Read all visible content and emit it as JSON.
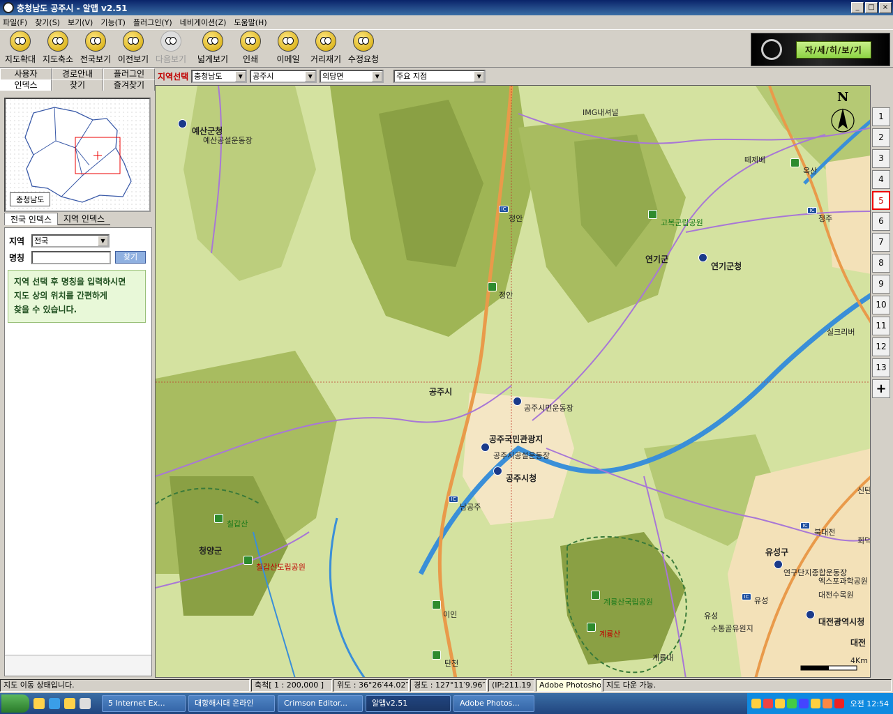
{
  "window": {
    "title": "충청남도 공주시 - 알맵 v2.51"
  },
  "menu": [
    "파일(F)",
    "찾기(S)",
    "보기(V)",
    "기능(T)",
    "플러그인(Y)",
    "네비게이션(Z)",
    "도움말(H)"
  ],
  "toolbar": {
    "items": [
      {
        "label": "지도확대",
        "icon": "zoom-in-icon",
        "enabled": true
      },
      {
        "label": "지도축소",
        "icon": "zoom-out-icon",
        "enabled": true
      },
      {
        "label": "전국보기",
        "icon": "country-view-icon",
        "enabled": true
      },
      {
        "label": "이전보기",
        "icon": "previous-view-icon",
        "enabled": true
      },
      {
        "label": "다음보기",
        "icon": "next-view-icon",
        "enabled": false
      },
      {
        "label": "넓게보기",
        "icon": "wide-view-icon",
        "enabled": true
      },
      {
        "label": "인쇄",
        "icon": "print-icon",
        "enabled": true
      },
      {
        "label": "이메일",
        "icon": "email-icon",
        "enabled": true
      },
      {
        "label": "거리재기",
        "icon": "measure-distance-icon",
        "enabled": true
      },
      {
        "label": "수정요청",
        "icon": "edit-request-icon",
        "enabled": true
      }
    ],
    "detail_button": "자/세/히/보/기"
  },
  "left_panel": {
    "tabs_row1": [
      "사용자",
      "경로안내",
      "플러그인"
    ],
    "tabs_row2": [
      "인덱스",
      "찾기",
      "즐겨찾기"
    ],
    "active_tab": "인덱스",
    "minimap_label": "충청남도",
    "subtabs": [
      "전국 인덱스",
      "지역 인덱스"
    ],
    "region_label": "지역",
    "region_value": "전국",
    "name_label": "명칭",
    "find_button": "찾기",
    "hint": [
      "지역 선택 후 명칭을 입력하시면",
      "지도 상의 위치를 간편하게",
      "찾을 수 있습니다."
    ]
  },
  "region_bar": {
    "label": "지역선택",
    "province": "충청남도",
    "city": "공주시",
    "town": "의당면",
    "poi": "주요 지점"
  },
  "map": {
    "compass": "N",
    "scale_text": "4Km",
    "labels": [
      {
        "text": "IMG내셔널",
        "style": "poi"
      },
      {
        "text": "예산군청",
        "style": "big"
      },
      {
        "text": "예산공설운동장",
        "style": "poi"
      },
      {
        "text": "떼제베",
        "style": "poi"
      },
      {
        "text": "옥산",
        "style": "poi"
      },
      {
        "text": "정안",
        "style": "poi"
      },
      {
        "text": "고복군립공원",
        "style": "green"
      },
      {
        "text": "청주",
        "style": "poi"
      },
      {
        "text": "연기군",
        "style": "big"
      },
      {
        "text": "연기군청",
        "style": "big"
      },
      {
        "text": "정안",
        "style": "poi"
      },
      {
        "text": "실크리버",
        "style": "poi"
      },
      {
        "text": "공주시",
        "style": "big"
      },
      {
        "text": "공주시민운동장",
        "style": "poi"
      },
      {
        "text": "공주국민관광지",
        "style": "big"
      },
      {
        "text": "공주시공설운동장",
        "style": "poi"
      },
      {
        "text": "공주시청",
        "style": "big"
      },
      {
        "text": "남공주",
        "style": "poi"
      },
      {
        "text": "칠갑산",
        "style": "green"
      },
      {
        "text": "청양군",
        "style": "big"
      },
      {
        "text": "칠갑산도립공원",
        "style": "red"
      },
      {
        "text": "북대전",
        "style": "poi"
      },
      {
        "text": "유성구",
        "style": "big"
      },
      {
        "text": "연구단지종합운동장",
        "style": "poi"
      },
      {
        "text": "엑스포과학공원",
        "style": "poi"
      },
      {
        "text": "대전수목원",
        "style": "poi"
      },
      {
        "text": "유성",
        "style": "poi"
      },
      {
        "text": "계룡산국립공원",
        "style": "green"
      },
      {
        "text": "이인",
        "style": "poi"
      },
      {
        "text": "유성",
        "style": "poi"
      },
      {
        "text": "수통골유원지",
        "style": "poi"
      },
      {
        "text": "대전광역시청",
        "style": "big"
      },
      {
        "text": "계룡산",
        "style": "red"
      },
      {
        "text": "대전",
        "style": "big"
      },
      {
        "text": "탄천",
        "style": "poi"
      },
      {
        "text": "계룡대",
        "style": "poi"
      },
      {
        "text": "신탄",
        "style": "poi"
      },
      {
        "text": "회덕",
        "style": "poi"
      }
    ],
    "colors": {
      "land": "#d4e2a0",
      "mountain": "#9fb555",
      "water": "#3a8fd8",
      "road_major": "#e99a4a",
      "road_minor": "#a877d6"
    }
  },
  "zoom_levels": [
    "1",
    "2",
    "3",
    "4",
    "5",
    "6",
    "7",
    "8",
    "9",
    "10",
    "11",
    "12",
    "13"
  ],
  "zoom_active": "5",
  "zoom_plus": "+",
  "status": {
    "message": "지도 이동 상태입니다.",
    "scale": "축척[ 1 : 200,000 ]",
    "lat": "위도 : 36°26′44.02″",
    "lon": "경도 : 127°11′9.96″",
    "ip": "(IP:211.19",
    "tooltip": "Adobe Photoshop",
    "extra": "지도 다운 가능."
  },
  "taskbar": {
    "tasks": [
      "5 Internet Ex...",
      "대항해시대 온라인",
      "Crimson Editor...",
      "알맵v2.51",
      "Adobe Photos..."
    ],
    "active_task": "알맵v2.51",
    "clock": "오전 12:54"
  }
}
